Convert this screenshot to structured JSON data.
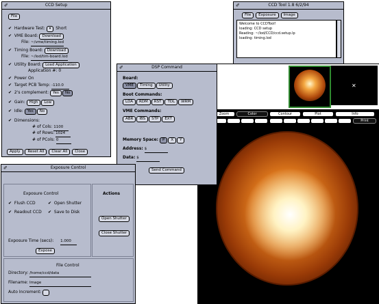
{
  "ccd_setup": {
    "title": "CCD Setup",
    "file_button": "File",
    "hardware_test": {
      "label": "Hardware Test:",
      "value": "Short"
    },
    "vme_board": {
      "label": "VME Board:",
      "button": "Download",
      "file_label": "File:",
      "file_value": "~/vme/timing.lod"
    },
    "timing_board": {
      "label": "Timing Board:",
      "button": "Download",
      "file_label": "File:",
      "file_value": "~/lod/tim-board.lod"
    },
    "utility_board": {
      "label": "Utility Board:",
      "button": "Load Application",
      "app_label": "Application #:",
      "app_value": "0"
    },
    "power_on": "Power On",
    "target_temp": {
      "label": "Target PCB Temp:",
      "value": "-110.0"
    },
    "twos_complement": {
      "label": "2's complement:",
      "options": [
        "Yes",
        "No"
      ]
    },
    "gain": {
      "label": "Gain:",
      "options": [
        "High",
        "Low"
      ]
    },
    "idle": {
      "label": "Idle:",
      "options": [
        "Yes",
        "No"
      ]
    },
    "dimensions": {
      "label": "Dimensions:",
      "cols": {
        "label": "# of Cols:",
        "value": "1100"
      },
      "rows": {
        "label": "# of Rows:",
        "value": "1024"
      },
      "pcols": {
        "label": "# of PCols:",
        "value": "0"
      }
    },
    "buttons": [
      "Apply",
      "Reset All",
      "Clear All",
      "Close"
    ]
  },
  "ccd_tool": {
    "title": "CCD Tool 1.8 6/2/94",
    "toolbar": [
      "File",
      "Exposure",
      "Image"
    ],
    "log": [
      "Welcome to CCDTool!",
      "loading: CCD setup",
      "Reading: ~/lod/CCD/ccd.setup.lp",
      "loading: timing.lod"
    ]
  },
  "dsp_command": {
    "title": "DSP Command",
    "board_label": "Board:",
    "boards": [
      "VME",
      "Timing",
      "Utility"
    ],
    "boot_label": "Boot Commands:",
    "boot_commands": [
      "LDA",
      "RDM",
      "RST",
      "TDL",
      "WRM"
    ],
    "vme_label": "VME Commands:",
    "vme_commands": [
      "ABR",
      "IBS",
      "STP",
      "EXT"
    ],
    "memory_label": "Memory Space:",
    "memory_options": [
      "P",
      "X",
      "Y"
    ],
    "address_label": "Address:",
    "address_value": "$",
    "data_label": "Data:",
    "data_value": "$",
    "send_button": "Send Command"
  },
  "exposure_control": {
    "title": "Exposure Control",
    "group_title": "Exposure Control",
    "options": [
      "Flush CCD",
      "Open Shutter",
      "Readout CCD",
      "Save to Disk"
    ],
    "time_label": "Exposure Time (secs):",
    "time_value": "1.000",
    "expose_button": "Expose",
    "actions_title": "Actions",
    "open_shutter": "Open Shutter",
    "close_shutter": "Close Shutter",
    "file_control_title": "File Control",
    "directory_label": "Directory:",
    "directory_value": "/home/ccd/data",
    "filename_label": "Filename:",
    "filename_value": "Image",
    "auto_inc_label": "Auto Increment:"
  },
  "image_view": {
    "buttons_row1": [
      "Zoom",
      "Color",
      "Contour",
      "Plot",
      "Info"
    ],
    "buttons_row2": [
      "",
      "",
      "",
      "",
      "",
      "",
      "",
      "",
      "",
      "",
      "Print"
    ]
  }
}
